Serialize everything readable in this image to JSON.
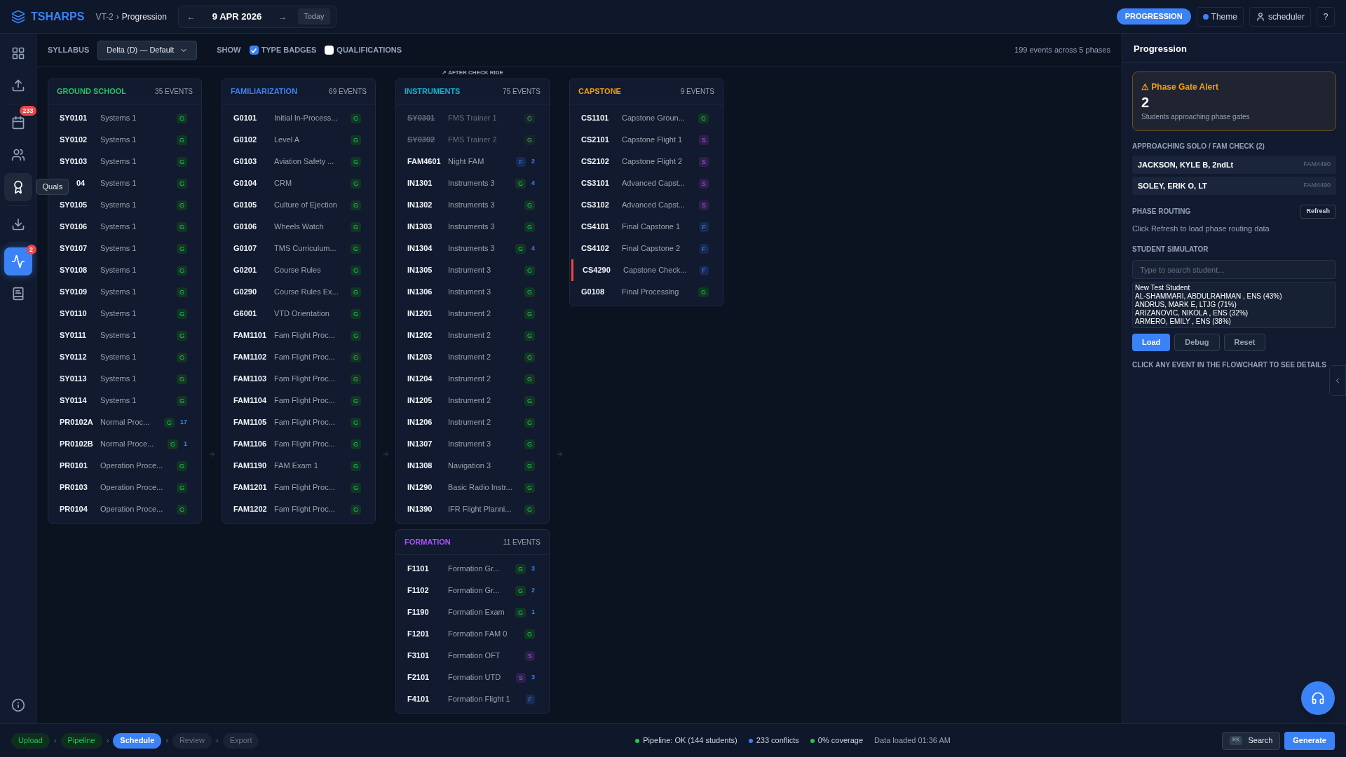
{
  "topbar": {
    "brand": "TSHARPS",
    "breadcrumb": [
      {
        "label": "VT-2"
      },
      {
        "label": "Progression"
      }
    ],
    "separator": "›",
    "date": {
      "prev": "←",
      "value": "9 APR 2026",
      "next": "→",
      "today": "Today"
    },
    "mode": "PROGRESSION",
    "theme": "Theme",
    "user": "scheduler",
    "help": "?"
  },
  "sidebar": {
    "items": [
      {
        "kind": "grid",
        "selected": false,
        "hovered": false
      },
      {
        "kind": "upload",
        "selected": false,
        "hovered": false
      },
      {
        "kind": "calendar",
        "selected": false,
        "hovered": false,
        "badge": "233"
      },
      {
        "kind": "users",
        "selected": false,
        "hovered": false
      },
      {
        "kind": "award",
        "selected": false,
        "hovered": true,
        "tooltip": "Quals"
      },
      {
        "kind": "download",
        "selected": false,
        "hovered": false
      },
      {
        "kind": "activity",
        "selected": true,
        "hovered": false,
        "badge": "2"
      },
      {
        "kind": "book",
        "selected": false,
        "hovered": false
      }
    ]
  },
  "toolbar": {
    "syllabus_label": "SYLLABUS",
    "syllabus": "Delta (D) — Default",
    "show_label": "SHOW",
    "toggles": [
      {
        "label": "TYPE BADGES",
        "checked": true
      },
      {
        "label": "QUALIFICATIONS",
        "checked": false
      }
    ],
    "summary": "199 events across 5 phases"
  },
  "flowchart": {
    "columns": [
      {
        "phases": [
          {
            "title": "GROUND SCHOOL",
            "count": "35 EVENTS",
            "color": "#22c55e",
            "rows": [
              {
                "code": "SY0101",
                "name": "Systems 1",
                "badge": "G",
                "kind": "ground",
                "disabled": false,
                "flagged": false
              },
              {
                "code": "SY0102",
                "name": "Systems 1",
                "badge": "G",
                "kind": "ground",
                "disabled": false,
                "flagged": false
              },
              {
                "code": "SY0103",
                "name": "Systems 1",
                "badge": "G",
                "kind": "ground",
                "disabled": false,
                "flagged": false
              },
              {
                "code": "04",
                "name": "Systems 1",
                "badge": "G",
                "kind": "ground",
                "disabled": false,
                "flagged": false,
                "covered": true
              },
              {
                "code": "SY0105",
                "name": "Systems 1",
                "badge": "G",
                "kind": "ground",
                "disabled": false,
                "flagged": false
              },
              {
                "code": "SY0106",
                "name": "Systems 1",
                "badge": "G",
                "kind": "ground",
                "disabled": false,
                "flagged": false
              },
              {
                "code": "SY0107",
                "name": "Systems 1",
                "badge": "G",
                "kind": "ground",
                "disabled": false,
                "flagged": false
              },
              {
                "code": "SY0108",
                "name": "Systems 1",
                "badge": "G",
                "kind": "ground",
                "disabled": false,
                "flagged": false
              },
              {
                "code": "SY0109",
                "name": "Systems 1",
                "badge": "G",
                "kind": "ground",
                "disabled": false,
                "flagged": false
              },
              {
                "code": "SY0110",
                "name": "Systems 1",
                "badge": "G",
                "kind": "ground",
                "disabled": false,
                "flagged": false
              },
              {
                "code": "SY0111",
                "name": "Systems 1",
                "badge": "G",
                "kind": "ground",
                "disabled": false,
                "flagged": false
              },
              {
                "code": "SY0112",
                "name": "Systems 1",
                "badge": "G",
                "kind": "ground",
                "disabled": false,
                "flagged": false
              },
              {
                "code": "SY0113",
                "name": "Systems 1",
                "badge": "G",
                "kind": "ground",
                "disabled": false,
                "flagged": false
              },
              {
                "code": "SY0114",
                "name": "Systems 1",
                "badge": "G",
                "kind": "ground",
                "disabled": false,
                "flagged": false
              },
              {
                "code": "PR0102A",
                "name": "Normal Proc...",
                "badge": "G",
                "kind": "ground",
                "count": "17",
                "disabled": false,
                "flagged": false
              },
              {
                "code": "PR0102B",
                "name": "Normal Proce...",
                "badge": "G",
                "kind": "ground",
                "count": "1",
                "disabled": false,
                "flagged": false
              },
              {
                "code": "PR0101",
                "name": "Operation Proce...",
                "badge": "G",
                "kind": "ground",
                "disabled": false,
                "flagged": false
              },
              {
                "code": "PR0103",
                "name": "Operation Proce...",
                "badge": "G",
                "kind": "ground",
                "disabled": false,
                "flagged": false
              },
              {
                "code": "PR0104",
                "name": "Operation Proce...",
                "badge": "G",
                "kind": "ground",
                "disabled": false,
                "flagged": false
              }
            ]
          }
        ]
      },
      {
        "phases": [
          {
            "title": "FAMILIARIZATION",
            "count": "69 EVENTS",
            "color": "#3b82f6",
            "rows": [
              {
                "code": "G0101",
                "name": "Initial In-Process...",
                "badge": "G",
                "kind": "ground",
                "disabled": false,
                "flagged": false
              },
              {
                "code": "G0102",
                "name": "Level A",
                "badge": "G",
                "kind": "ground",
                "disabled": false,
                "flagged": false
              },
              {
                "code": "G0103",
                "name": "Aviation Safety ...",
                "badge": "G",
                "kind": "ground",
                "disabled": false,
                "flagged": false
              },
              {
                "code": "G0104",
                "name": "CRM",
                "badge": "G",
                "kind": "ground",
                "disabled": false,
                "flagged": false
              },
              {
                "code": "G0105",
                "name": "Culture of Ejection",
                "badge": "G",
                "kind": "ground",
                "disabled": false,
                "flagged": false
              },
              {
                "code": "G0106",
                "name": "Wheels Watch",
                "badge": "G",
                "kind": "ground",
                "disabled": false,
                "flagged": false
              },
              {
                "code": "G0107",
                "name": "TMS Curriculum...",
                "badge": "G",
                "kind": "ground",
                "disabled": false,
                "flagged": false
              },
              {
                "code": "G0201",
                "name": "Course Rules",
                "badge": "G",
                "kind": "ground",
                "disabled": false,
                "flagged": false
              },
              {
                "code": "G0290",
                "name": "Course Rules Ex...",
                "badge": "G",
                "kind": "ground",
                "disabled": false,
                "flagged": false
              },
              {
                "code": "G6001",
                "name": "VTD Orientation",
                "badge": "G",
                "kind": "ground",
                "disabled": false,
                "flagged": false
              },
              {
                "code": "FAM1101",
                "name": "Fam Flight Proc...",
                "badge": "G",
                "kind": "ground",
                "disabled": false,
                "flagged": false
              },
              {
                "code": "FAM1102",
                "name": "Fam Flight Proc...",
                "badge": "G",
                "kind": "ground",
                "disabled": false,
                "flagged": false
              },
              {
                "code": "FAM1103",
                "name": "Fam Flight Proc...",
                "badge": "G",
                "kind": "ground",
                "disabled": false,
                "flagged": false
              },
              {
                "code": "FAM1104",
                "name": "Fam Flight Proc...",
                "badge": "G",
                "kind": "ground",
                "disabled": false,
                "flagged": false
              },
              {
                "code": "FAM1105",
                "name": "Fam Flight Proc...",
                "badge": "G",
                "kind": "ground",
                "disabled": false,
                "flagged": false
              },
              {
                "code": "FAM1106",
                "name": "Fam Flight Proc...",
                "badge": "G",
                "kind": "ground",
                "disabled": false,
                "flagged": false
              },
              {
                "code": "FAM1190",
                "name": "FAM Exam 1",
                "badge": "G",
                "kind": "ground",
                "disabled": false,
                "flagged": false
              },
              {
                "code": "FAM1201",
                "name": "Fam Flight Proc...",
                "badge": "G",
                "kind": "ground",
                "disabled": false,
                "flagged": false
              },
              {
                "code": "FAM1202",
                "name": "Fam Flight Proc...",
                "badge": "G",
                "kind": "ground",
                "disabled": false,
                "flagged": false
              }
            ]
          }
        ]
      },
      {
        "phases": [
          {
            "note": "↗ AFTER CHECK RIDE",
            "title": "INSTRUMENTS",
            "count": "75 EVENTS",
            "color": "#06b6d4",
            "rows": [
              {
                "code": "SY0301",
                "name": "FMS Trainer 1",
                "badge": "G",
                "kind": "ground",
                "disabled": true,
                "flagged": false
              },
              {
                "code": "SY0302",
                "name": "FMS Trainer 2",
                "badge": "G",
                "kind": "ground",
                "disabled": true,
                "flagged": false
              },
              {
                "code": "FAM4601",
                "name": "Night FAM",
                "badge": "F",
                "kind": "flight",
                "count": "2",
                "disabled": false,
                "flagged": false
              },
              {
                "code": "IN1301",
                "name": "Instruments 3",
                "badge": "G",
                "kind": "ground",
                "count": "4",
                "disabled": false,
                "flagged": false
              },
              {
                "code": "IN1302",
                "name": "Instruments 3",
                "badge": "G",
                "kind": "ground",
                "disabled": false,
                "flagged": false
              },
              {
                "code": "IN1303",
                "name": "Instruments 3",
                "badge": "G",
                "kind": "ground",
                "disabled": false,
                "flagged": false
              },
              {
                "code": "IN1304",
                "name": "Instruments 3",
                "badge": "G",
                "kind": "ground",
                "count": "4",
                "disabled": false,
                "flagged": false
              },
              {
                "code": "IN1305",
                "name": "Instrument 3",
                "badge": "G",
                "kind": "ground",
                "disabled": false,
                "flagged": false
              },
              {
                "code": "IN1306",
                "name": "Instrument 3",
                "badge": "G",
                "kind": "ground",
                "disabled": false,
                "flagged": false
              },
              {
                "code": "IN1201",
                "name": "Instrument 2",
                "badge": "G",
                "kind": "ground",
                "disabled": false,
                "flagged": false
              },
              {
                "code": "IN1202",
                "name": "Instrument 2",
                "badge": "G",
                "kind": "ground",
                "disabled": false,
                "flagged": false
              },
              {
                "code": "IN1203",
                "name": "Instrument 2",
                "badge": "G",
                "kind": "ground",
                "disabled": false,
                "flagged": false
              },
              {
                "code": "IN1204",
                "name": "Instrument 2",
                "badge": "G",
                "kind": "ground",
                "disabled": false,
                "flagged": false
              },
              {
                "code": "IN1205",
                "name": "Instrument 2",
                "badge": "G",
                "kind": "ground",
                "disabled": false,
                "flagged": false
              },
              {
                "code": "IN1206",
                "name": "Instrument 2",
                "badge": "G",
                "kind": "ground",
                "disabled": false,
                "flagged": false
              },
              {
                "code": "IN1307",
                "name": "Instrument 3",
                "badge": "G",
                "kind": "ground",
                "disabled": false,
                "flagged": false
              },
              {
                "code": "IN1308",
                "name": "Navigation 3",
                "badge": "G",
                "kind": "ground",
                "disabled": false,
                "flagged": false
              },
              {
                "code": "IN1290",
                "name": "Basic Radio Instr...",
                "badge": "G",
                "kind": "ground",
                "disabled": false,
                "flagged": false
              },
              {
                "code": "IN1390",
                "name": "IFR Flight Planni...",
                "badge": "G",
                "kind": "ground",
                "disabled": false,
                "flagged": false
              }
            ]
          },
          {
            "title": "FORMATION",
            "count": "11 EVENTS",
            "color": "#a855f7",
            "rows": [
              {
                "code": "F1101",
                "name": "Formation Gr...",
                "badge": "G",
                "kind": "ground",
                "count": "3",
                "disabled": false,
                "flagged": false
              },
              {
                "code": "F1102",
                "name": "Formation Gr...",
                "badge": "G",
                "kind": "ground",
                "count": "2",
                "disabled": false,
                "flagged": false
              },
              {
                "code": "F1190",
                "name": "Formation Exam",
                "badge": "G",
                "kind": "ground",
                "count": "1",
                "disabled": false,
                "flagged": false
              },
              {
                "code": "F1201",
                "name": "Formation FAM 0",
                "badge": "G",
                "kind": "ground",
                "disabled": false,
                "flagged": false
              },
              {
                "code": "F3101",
                "name": "Formation OFT",
                "badge": "S",
                "kind": "sim",
                "disabled": false,
                "flagged": false
              },
              {
                "code": "F2101",
                "name": "Formation UTD",
                "badge": "S",
                "kind": "sim",
                "count": "3",
                "disabled": false,
                "flagged": false
              },
              {
                "code": "F4101",
                "name": "Formation Flight 1",
                "badge": "F",
                "kind": "flight",
                "disabled": false,
                "flagged": false
              }
            ]
          }
        ]
      },
      {
        "phases": [
          {
            "title": "CAPSTONE",
            "count": "9 EVENTS",
            "color": "#f59e0b",
            "rows": [
              {
                "code": "CS1101",
                "name": "Capstone Groun...",
                "badge": "G",
                "kind": "ground",
                "disabled": false,
                "flagged": false
              },
              {
                "code": "CS2101",
                "name": "Capstone Flight 1",
                "badge": "S",
                "kind": "sim",
                "disabled": false,
                "flagged": false
              },
              {
                "code": "CS2102",
                "name": "Capstone Flight 2",
                "badge": "S",
                "kind": "sim",
                "disabled": false,
                "flagged": false
              },
              {
                "code": "CS3101",
                "name": "Advanced Capst...",
                "badge": "S",
                "kind": "sim",
                "disabled": false,
                "flagged": false
              },
              {
                "code": "CS3102",
                "name": "Advanced Capst...",
                "badge": "S",
                "kind": "sim",
                "disabled": false,
                "flagged": false
              },
              {
                "code": "CS4101",
                "name": "Final Capstone 1",
                "badge": "F",
                "kind": "flight",
                "disabled": false,
                "flagged": false
              },
              {
                "code": "CS4102",
                "name": "Final Capstone 2",
                "badge": "F",
                "kind": "flight",
                "disabled": false,
                "flagged": false
              },
              {
                "code": "CS4290",
                "name": "Capstone Check...",
                "badge": "F",
                "kind": "flight",
                "disabled": false,
                "flagged": true
              },
              {
                "code": "G0108",
                "name": "Final Processing",
                "badge": "G",
                "kind": "ground",
                "disabled": false,
                "flagged": false
              }
            ]
          }
        ]
      }
    ]
  },
  "panel": {
    "title": "Progression",
    "alert": {
      "icon": "⚠",
      "title": "Phase Gate Alert",
      "value": "2",
      "caption": "Students approaching phase gates"
    },
    "approaching": {
      "title": "APPROACHING SOLO / FAM CHECK (2)",
      "students": [
        {
          "name": "JACKSON, KYLE B, 2ndLt",
          "event": "FAM4490"
        },
        {
          "name": "SOLEY, ERIK O, LT",
          "event": "FAM4490"
        }
      ]
    },
    "routing": {
      "title": "PHASE ROUTING",
      "button": "Refresh",
      "hint": "Click Refresh to load phase routing data"
    },
    "simulator": {
      "title": "STUDENT SIMULATOR",
      "placeholder": "Type to search student...",
      "options": [
        "New Test Student",
        "AL-SHAMMARI, ABDULRAHMAN , ENS (43%)",
        "ANDRUS, MARK E, LTJG (71%)",
        "ARIZANOVIC, NIKOLA , ENS (32%)",
        "ARMERO, EMILY , ENS (38%)"
      ],
      "buttons": [
        {
          "label": "Load",
          "primary": true
        },
        {
          "label": "Debug",
          "primary": false
        },
        {
          "label": "Reset",
          "primary": false
        }
      ]
    },
    "hint": "CLICK ANY EVENT IN THE FLOWCHART TO SEE DETAILS"
  },
  "status_bar": {
    "steps": [
      {
        "label": "Upload",
        "kind": "done"
      },
      {
        "label": "Pipeline",
        "kind": "done"
      },
      {
        "label": "Schedule",
        "kind": "active"
      },
      {
        "label": "Review",
        "kind": "pending"
      },
      {
        "label": "Export",
        "kind": "pending"
      }
    ],
    "step_separator": "›",
    "indicators": [
      {
        "text": "Pipeline: OK (144 students)",
        "color": "#22c55e"
      },
      {
        "text": "233 conflicts",
        "color": "#3b82f6"
      },
      {
        "text": "0% coverage",
        "color": "#22c55e"
      }
    ],
    "loaded": "Data loaded 01:36 AM",
    "shortcut": "⌘K",
    "search": "Search",
    "generate": "Generate"
  }
}
